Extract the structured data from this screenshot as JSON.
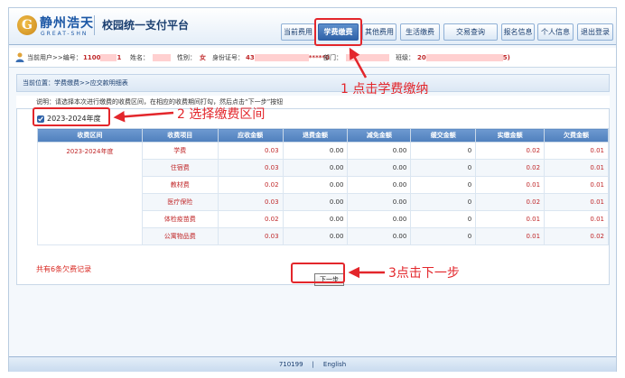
{
  "header": {
    "logo_mark": "G",
    "logo_cn": "静州浩天",
    "logo_en": "GREAT-SHN",
    "system_title": "校园统一支付平台",
    "nav": [
      {
        "label": "当前费用"
      },
      {
        "label": "学费缴费"
      },
      {
        "label": "其他费用"
      },
      {
        "label": "生活缴费"
      },
      {
        "label": "交易查询"
      },
      {
        "label": "报名信息"
      },
      {
        "label": "个人信息"
      },
      {
        "label": "退出登录"
      }
    ]
  },
  "userbar": {
    "current_user": "当前用户>>编号：",
    "number_value": "1100",
    "number_tail": "1",
    "name_label": "姓名：",
    "gender_label": "性别：",
    "gender_value": "女",
    "id_label": "身份证号：",
    "id_head": "43",
    "id_tail": "*****0",
    "dept_label": "部门：",
    "class_label": "班级：",
    "class_head": "20",
    "class_tail": "5)"
  },
  "breadcrumb": "当前位置：学费缴费>>应交款明细表",
  "notice": "说明：请选择本次进行缴费的收费区间，在相应的收费期间打勾，然后点击“下一步”按钮",
  "term_checkbox_label": "2023-2024年度",
  "table": {
    "headers": [
      "收费区间",
      "收费项目",
      "应收金额",
      "退费金额",
      "减免金额",
      "缓交金额",
      "实缴金额",
      "欠费金额"
    ],
    "term": "2023-2024年度",
    "rows": [
      {
        "item": "学费",
        "due": "0.03",
        "refund": "0.00",
        "waiver": "0.00",
        "deferred": "0",
        "paid": "0.02",
        "owed": "0.01"
      },
      {
        "item": "住宿费",
        "due": "0.03",
        "refund": "0.00",
        "waiver": "0.00",
        "deferred": "0",
        "paid": "0.02",
        "owed": "0.01"
      },
      {
        "item": "教材费",
        "due": "0.02",
        "refund": "0.00",
        "waiver": "0.00",
        "deferred": "0",
        "paid": "0.01",
        "owed": "0.01"
      },
      {
        "item": "医疗保险",
        "due": "0.03",
        "refund": "0.00",
        "waiver": "0.00",
        "deferred": "0",
        "paid": "0.02",
        "owed": "0.01"
      },
      {
        "item": "体检疫苗费",
        "due": "0.02",
        "refund": "0.00",
        "waiver": "0.00",
        "deferred": "0",
        "paid": "0.01",
        "owed": "0.01"
      },
      {
        "item": "公寓物品费",
        "due": "0.03",
        "refund": "0.00",
        "waiver": "0.00",
        "deferred": "0",
        "paid": "0.01",
        "owed": "0.02"
      }
    ]
  },
  "owed_summary": "共有6条欠费记录",
  "next_button": "下一步",
  "footer": {
    "code": "710199",
    "separator": "|",
    "language": "English"
  },
  "annotations": {
    "step1": "1 点击学费缴纳",
    "step2": "2 选择缴费区间",
    "step3": "3点击下一步"
  },
  "colors": {
    "annotation_red": "#e3262b",
    "nav_active": "#2f62a8",
    "header_blue": "#4f7fbd",
    "amount_red": "#c0282a"
  }
}
